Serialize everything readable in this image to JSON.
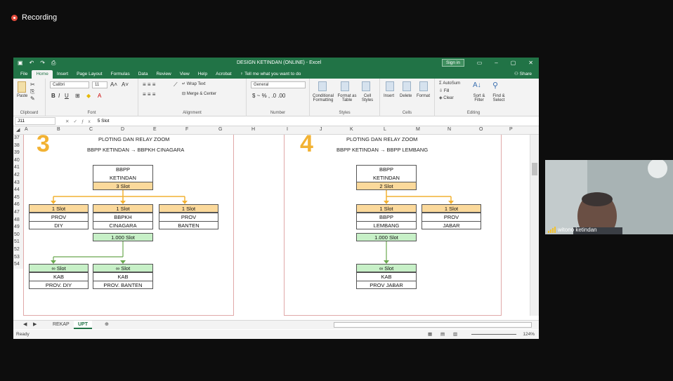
{
  "recording": {
    "label": "Recording"
  },
  "excel": {
    "title": "DESIGN KETINDAN (ONLINE) - Excel",
    "sign_in": "Sign in",
    "tabs": [
      "File",
      "Home",
      "Insert",
      "Page Layout",
      "Formulas",
      "Data",
      "Review",
      "View",
      "Help",
      "Acrobat",
      "Tell me what you want to do"
    ],
    "share": "Share",
    "ribbon": {
      "clipboard": {
        "label": "Clipboard",
        "paste": "Paste"
      },
      "font": {
        "label": "Font",
        "name": "Calibri",
        "size": "11"
      },
      "alignment": {
        "label": "Alignment",
        "wrap": "Wrap Text",
        "merge": "Merge & Center"
      },
      "number": {
        "label": "Number",
        "format": "General"
      },
      "styles": {
        "label": "Styles",
        "conditional": "Conditional Formatting",
        "format_table": "Format as Table",
        "cell_styles": "Cell Styles"
      },
      "cells": {
        "label": "Cells",
        "insert": "Insert",
        "delete": "Delete",
        "format": "Format"
      },
      "editing": {
        "label": "Editing",
        "autosum": "AutoSum",
        "fill": "Fill",
        "clear": "Clear",
        "sort": "Sort & Filter",
        "find": "Find & Select"
      }
    },
    "formula_bar": {
      "name_box": "J11",
      "formula": "5 Slot"
    },
    "columns": [
      "A",
      "B",
      "C",
      "D",
      "E",
      "F",
      "G",
      "H",
      "I",
      "J",
      "K",
      "L",
      "M",
      "N",
      "O",
      "P"
    ],
    "rows": [
      "37",
      "38",
      "39",
      "40",
      "41",
      "42",
      "43",
      "44",
      "45",
      "46",
      "47",
      "48",
      "49",
      "50",
      "51",
      "52",
      "53",
      "54"
    ],
    "sheets": [
      "REKAP",
      "UPT"
    ],
    "status": "Ready",
    "zoom": "124%"
  },
  "panel3": {
    "number": "3",
    "title": "PLOTING DAN RELAY ZOOM",
    "subtitle": "BBPP KETINDAN → BBPKH CINAGARA",
    "root": [
      "BBPP",
      "KETINDAN",
      "3 Slot"
    ],
    "mid": [
      {
        "slot": "1 Slot",
        "l1": "PROV",
        "l2": "DIY"
      },
      {
        "slot": "1 Slot",
        "l1": "BBPKH",
        "l2": "CINAGARA",
        "extra": "1.000 Slot"
      },
      {
        "slot": "1 Slot",
        "l1": "PROV",
        "l2": "BANTEN"
      }
    ],
    "bottom": [
      {
        "slot": "∞ Slot",
        "l1": "KAB",
        "l2": "PROV. DIY"
      },
      {
        "slot": "∞ Slot",
        "l1": "KAB",
        "l2": "PROV. BANTEN"
      }
    ]
  },
  "panel4": {
    "number": "4",
    "title": "PLOTING DAN RELAY ZOOM",
    "subtitle": "BBPP KETINDAN → BBPP LEMBANG",
    "root": [
      "BBPP",
      "KETINDAN",
      "2 Slot"
    ],
    "mid": [
      {
        "slot": "1 Slot",
        "l1": "BBPP",
        "l2": "LEMBANG",
        "extra": "1.000 Slot"
      },
      {
        "slot": "1 Slot",
        "l1": "PROV",
        "l2": "JABAR"
      }
    ],
    "bottom": [
      {
        "slot": "∞ Slot",
        "l1": "KAB",
        "l2": "PROV JABAR"
      }
    ]
  },
  "video": {
    "name": "witono ketindan"
  }
}
